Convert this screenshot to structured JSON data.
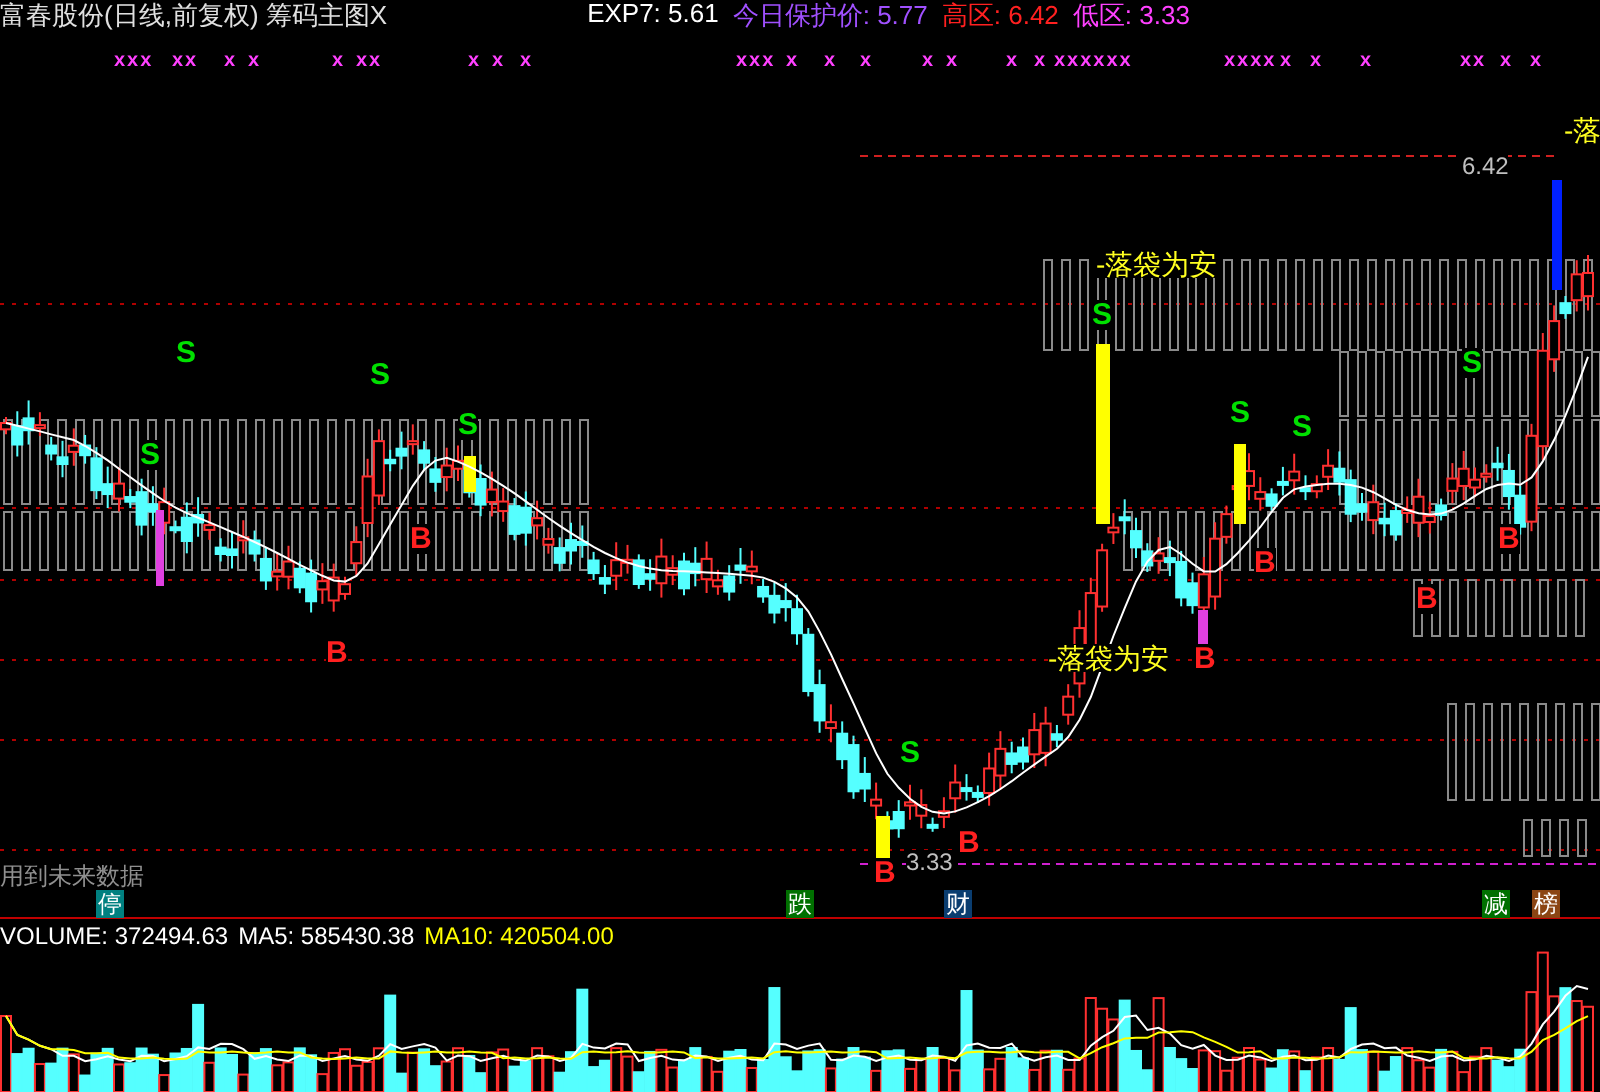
{
  "header": {
    "title": "富春股份(日线,前复权) 筹码主图X",
    "indicators": [
      {
        "label": "EXP7: 5.61",
        "color": "#ffffff"
      },
      {
        "label": "今日保护价: 5.77",
        "color": "#a050ff"
      },
      {
        "label": "高区: 6.42",
        "color": "#ff2020"
      },
      {
        "label": "低区: 3.33",
        "color": "#ff40ff"
      }
    ]
  },
  "marks": [
    "xxx",
    "xx",
    "x",
    "x",
    "x",
    "xx",
    "x",
    "x",
    "x",
    "xxx",
    "x",
    "x",
    "x",
    "x",
    "x",
    "x",
    "x",
    "xxxxxx",
    "xxxx",
    "x",
    "x",
    "x",
    "xx",
    "x",
    "x"
  ],
  "signals": [
    {
      "label": "S",
      "kind": "sell"
    },
    {
      "label": "S",
      "kind": "sell"
    },
    {
      "label": "B",
      "kind": "buy"
    },
    {
      "label": "S",
      "kind": "sell"
    },
    {
      "label": "B",
      "kind": "buy"
    },
    {
      "label": "S",
      "kind": "sell"
    },
    {
      "label": "B",
      "kind": "buy"
    },
    {
      "label": "S",
      "kind": "sell"
    },
    {
      "label": "B",
      "kind": "buy"
    },
    {
      "label": "S",
      "kind": "sell"
    },
    {
      "label": "B",
      "kind": "buy"
    },
    {
      "label": "S",
      "kind": "sell"
    },
    {
      "label": "B",
      "kind": "buy"
    },
    {
      "label": "S",
      "kind": "sell"
    },
    {
      "label": "B",
      "kind": "buy"
    },
    {
      "label": "S",
      "kind": "sell"
    },
    {
      "label": "B",
      "kind": "buy"
    }
  ],
  "annotations": [
    "-落袋为安",
    "-落袋为安",
    "-落"
  ],
  "price_labels": [
    "6.42",
    "3.33"
  ],
  "note": "用到未来数据",
  "badges": [
    {
      "label": "停",
      "color": "#008080"
    },
    {
      "label": "跌",
      "color": "#007000"
    },
    {
      "label": "财",
      "color": "#0a3d70"
    },
    {
      "label": "减",
      "color": "#007000"
    },
    {
      "label": "榜",
      "color": "#8b4513"
    }
  ],
  "volume_header": [
    {
      "label": "VOLUME: 372494.63",
      "color": "#ffffff"
    },
    {
      "label": "MA5: 585430.38",
      "color": "#ffffff"
    },
    {
      "label": "MA10: 420504.00",
      "color": "#ffff00"
    }
  ]
}
